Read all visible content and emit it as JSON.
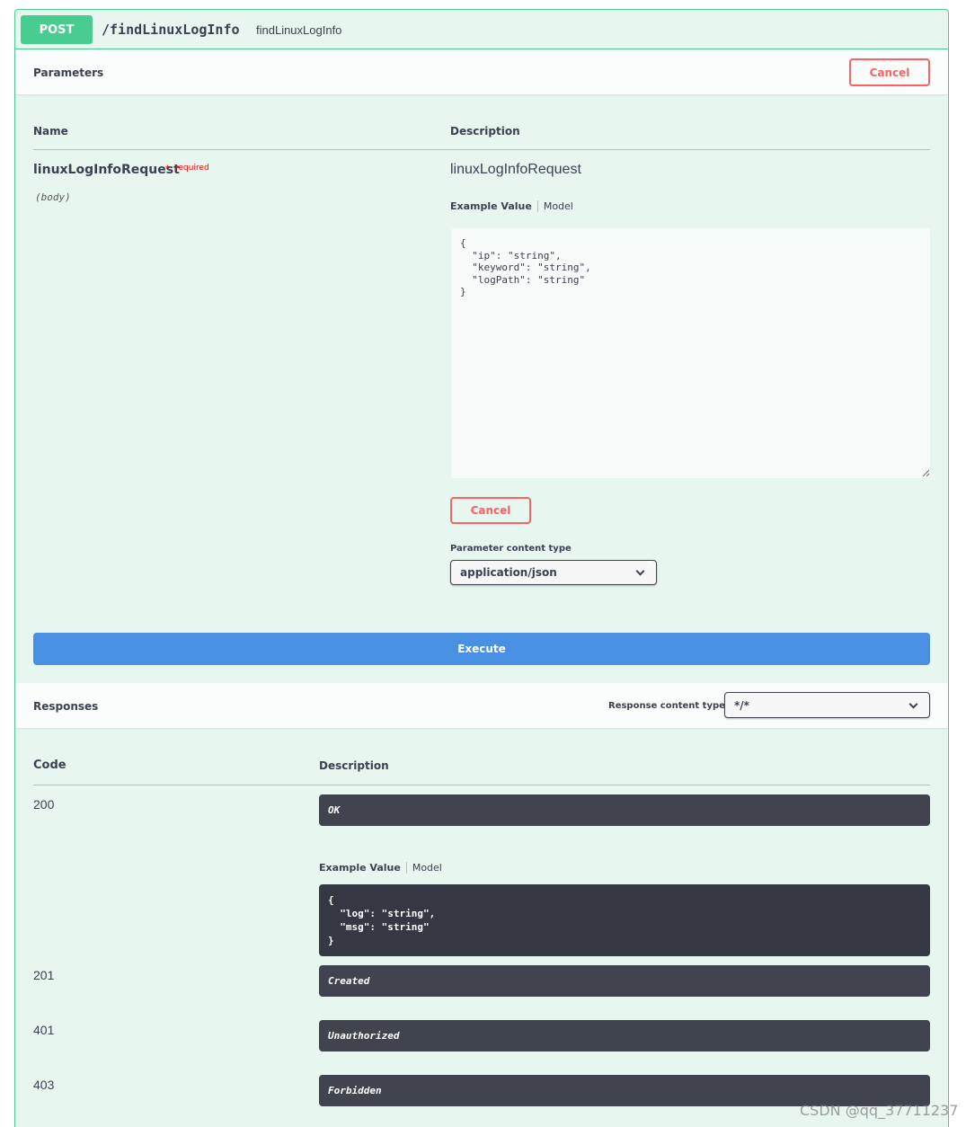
{
  "operation": {
    "method": "POST",
    "path": "/findLinuxLogInfo",
    "description": "findLinuxLogInfo"
  },
  "parameters": {
    "section_title": "Parameters",
    "cancel_label": "Cancel",
    "col_name": "Name",
    "col_description": "Description",
    "param": {
      "name": "linuxLogInfoRequest",
      "required_star": "*",
      "required_text": "required",
      "in": "(body)",
      "title": "linuxLogInfoRequest",
      "tab_example": "Example Value",
      "tab_model": "Model",
      "body_value": "{\n  \"ip\": \"string\",\n  \"keyword\": \"string\",\n  \"logPath\": \"string\"\n}",
      "cancel_label": "Cancel",
      "content_type_label": "Parameter content type",
      "content_type_value": "application/json"
    },
    "execute_label": "Execute"
  },
  "responses": {
    "section_title": "Responses",
    "content_type_label": "Response content type",
    "content_type_value": "*/*",
    "col_code": "Code",
    "col_description": "Description",
    "rows": [
      {
        "code": "200",
        "description": "OK"
      },
      {
        "code": "201",
        "description": "Created"
      },
      {
        "code": "401",
        "description": "Unauthorized"
      },
      {
        "code": "403",
        "description": "Forbidden"
      }
    ],
    "tab_example": "Example Value",
    "tab_model": "Model",
    "example_value": "{\n  \"log\": \"string\",\n  \"msg\": \"string\"\n}"
  },
  "watermark": "CSDN @qq_37711237",
  "colors": {
    "post_green": "#49cc90",
    "cancel_red": "#ff6060",
    "execute_blue": "#4990e2",
    "dark_box": "#41444e"
  }
}
